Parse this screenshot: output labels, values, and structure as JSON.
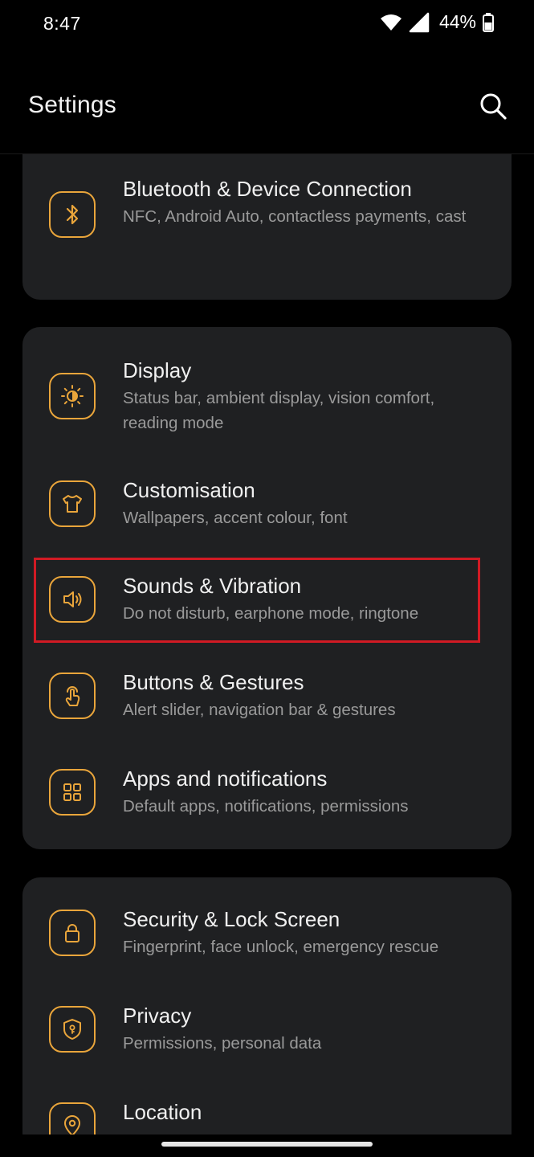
{
  "status_bar": {
    "time": "8:47",
    "battery": "44%"
  },
  "header": {
    "title": "Settings"
  },
  "cards": [
    {
      "items": [
        {
          "title": "Bluetooth & Device Connection",
          "subtitle": "NFC, Android Auto, contactless payments, cast",
          "icon": "bluetooth-icon"
        }
      ]
    },
    {
      "items": [
        {
          "title": "Display",
          "subtitle": "Status bar, ambient display, vision comfort, reading mode",
          "icon": "brightness-icon"
        },
        {
          "title": "Customisation",
          "subtitle": "Wallpapers, accent colour, font",
          "icon": "tshirt-icon"
        },
        {
          "title": "Sounds & Vibration",
          "subtitle": "Do not disturb, earphone mode, ringtone",
          "icon": "speaker-icon"
        },
        {
          "title": "Buttons & Gestures",
          "subtitle": "Alert slider, navigation bar & gestures",
          "icon": "touch-gesture-icon"
        },
        {
          "title": "Apps and notifications",
          "subtitle": "Default apps, notifications, permissions",
          "icon": "apps-grid-icon"
        }
      ]
    },
    {
      "items": [
        {
          "title": "Security & Lock Screen",
          "subtitle": "Fingerprint, face unlock, emergency rescue",
          "icon": "lock-icon"
        },
        {
          "title": "Privacy",
          "subtitle": "Permissions, personal data",
          "icon": "privacy-shield-icon"
        },
        {
          "title": "Location",
          "subtitle": "",
          "icon": "location-pin-icon"
        }
      ]
    }
  ],
  "colors": {
    "background": "#000000",
    "card": "#1f2022",
    "accent": "#e9a53b",
    "highlight": "#d11a24",
    "subtitle": "#9a9a9a"
  }
}
